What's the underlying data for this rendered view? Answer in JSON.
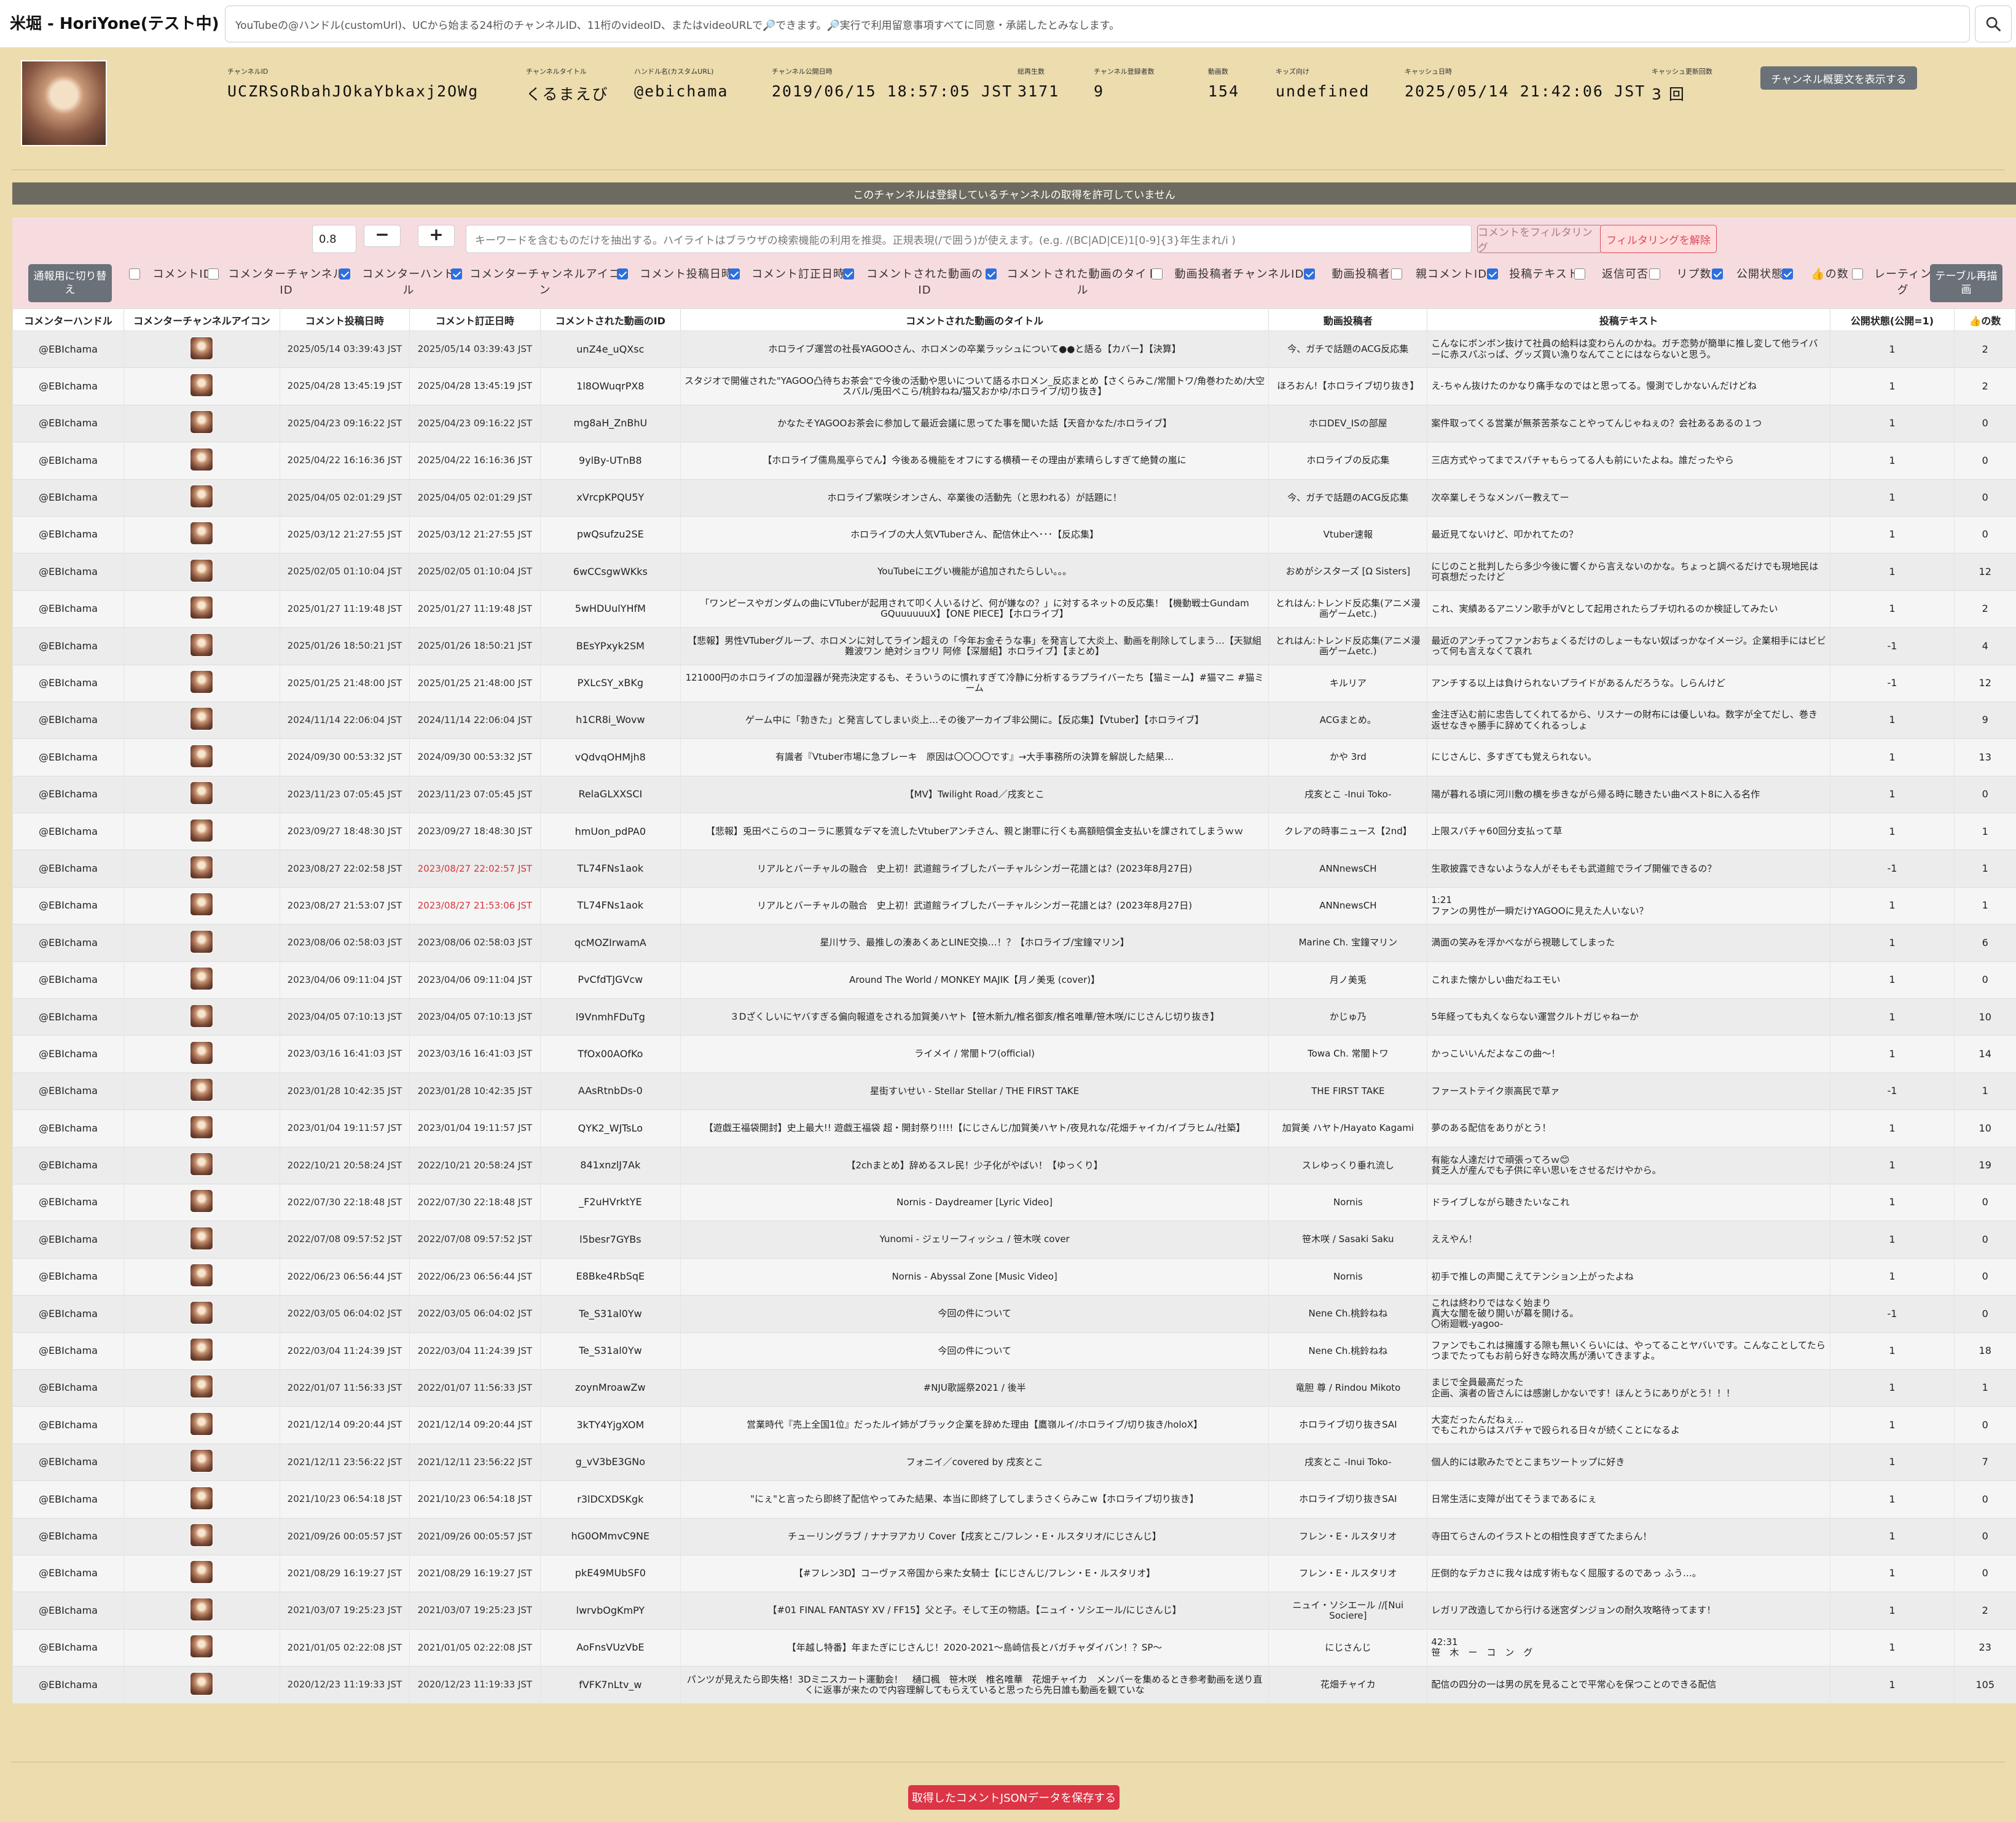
{
  "app": {
    "title": "米堀 - HoriYone(テスト中)"
  },
  "search": {
    "placeholder": "YouTubeの@ハンドル(customUrl)、UCから始まる24桁のチャンネルID、11桁のvideoID、またはvideoURLで🔎できます。🔎実行で利用留意事項すべてに同意・承諾したとみなします。"
  },
  "channel": {
    "labels": {
      "id": "チャンネルID",
      "title": "チャンネルタイトル",
      "handle": "ハンドル名(カスタムURL)",
      "published": "チャンネル公開日時",
      "views": "総再生数",
      "subscribers": "チャンネル登録者数",
      "videos": "動画数",
      "kids": "キッズ向け",
      "cached": "キャッシュ日時",
      "cache_count": "キャッシュ更新回数"
    },
    "id": "UCZRSoRbahJOkaYbkaxj2OWg",
    "title": "くるまえび",
    "handle": "@ebichama",
    "published": "2019/06/15 18:57:05 JST",
    "views": "3171",
    "subscribers": "9",
    "videos": "154",
    "kids": "undefined",
    "cached": "2025/05/14 21:42:06 JST",
    "cache_count": "3 回",
    "show_about_label": "チャンネル概要文を表示する"
  },
  "notice": "このチャンネルは登録しているチャンネルの取得を許可していません",
  "filter": {
    "zoom": "0.8",
    "minus": "−",
    "plus": "+",
    "placeholder": "キーワードを含むものだけを抽出する。ハイライトはブラウザの検索機能の利用を推奨。正規表現(/で囲う)が使えます。(e.g. /(BC|AD|CE)1[0-9]{3}年生まれ/i )",
    "filter_label": "コメントをフィルタリング",
    "clear_label": "フィルタリングを解除",
    "mobile_label": "通報用に切り替え",
    "redraw_label": "テーブル再描画",
    "toggles": [
      {
        "label": "コメントID",
        "checked": false
      },
      {
        "label": "コメンターチャンネルID",
        "checked": false
      },
      {
        "label": "コメンターハンドル",
        "checked": true
      },
      {
        "label": "コメンターチャンネルアイコン",
        "checked": true
      },
      {
        "label": "コメント投稿日時",
        "checked": true
      },
      {
        "label": "コメント訂正日時",
        "checked": true
      },
      {
        "label": "コメントされた動画のID",
        "checked": true
      },
      {
        "label": "コメントされた動画のタイトル",
        "checked": true
      },
      {
        "label": "動画投稿者チャンネルID",
        "checked": false
      },
      {
        "label": "動画投稿者",
        "checked": true
      },
      {
        "label": "親コメントID",
        "checked": false
      },
      {
        "label": "投稿テキスト",
        "checked": true
      },
      {
        "label": "返信可否",
        "checked": false
      },
      {
        "label": "リプ数",
        "checked": false
      },
      {
        "label": "公開状態",
        "checked": true
      },
      {
        "label": "👍の数",
        "checked": true
      },
      {
        "label": "レーティング",
        "checked": false
      }
    ]
  },
  "table": {
    "headers": [
      "コメンターハンドル",
      "コメンターチャンネルアイコン",
      "コメント投稿日時",
      "コメント訂正日時",
      "コメントされた動画のID",
      "コメントされた動画のタイトル",
      "動画投稿者",
      "投稿テキスト",
      "公開状態(公開=1)",
      "👍の数"
    ],
    "rows": [
      {
        "handle": "@EBIchama",
        "posted": "2025/05/14 03:39:43 JST",
        "edited": "2025/05/14 03:39:43 JST",
        "edited_flag": false,
        "video_id": "unZ4e_uQXsc",
        "title": "ホロライブ運営の社長YAGOOさん、ホロメンの卒業ラッシュについて●●と語る【カバー】【決算】",
        "uploader": "今、ガチで話題のACG反応集",
        "text": "こんなにボンボン抜けて社員の給料は変わらんのかね。ガチ恋勢が簡単に推し変して他ライバーに赤スパぶっぱ、グッズ買い漁りなんてことにはならないと思う。",
        "status": "1",
        "likes": "2"
      },
      {
        "handle": "@EBIchama",
        "posted": "2025/04/28 13:45:19 JST",
        "edited": "2025/04/28 13:45:19 JST",
        "edited_flag": false,
        "video_id": "1l8OWuqrPX8",
        "title": "スタジオで開催された\"YAGOO凸待ちお茶会\"で今後の活動や思いについて語るホロメン_反応まとめ【さくらみこ/常闇トワ/角巻わため/大空スバル/兎田ぺこら/桃鈴ねね/猫又おかゆ/ホロライブ/切り抜き】",
        "uploader": "ほろおん!【ホロライブ切り抜き】",
        "text": "え-ちゃん抜けたのかなり痛手なのではと思ってる。慢測でしかないんだけどね",
        "status": "1",
        "likes": "2"
      },
      {
        "handle": "@EBIchama",
        "posted": "2025/04/23 09:16:22 JST",
        "edited": "2025/04/23 09:16:22 JST",
        "edited_flag": false,
        "video_id": "mg8aH_ZnBhU",
        "title": "かなたそYAGOOお茶会に参加して最近会議に思ってた事を聞いた話【天音かなた/ホロライブ】",
        "uploader": "ホロDEV_ISの部屋",
        "text": "案件取ってくる営業が無茶苦茶なことやってんじゃねぇの？会社あるあるの１つ",
        "status": "1",
        "likes": "0"
      },
      {
        "handle": "@EBIchama",
        "posted": "2025/04/22 16:16:36 JST",
        "edited": "2025/04/22 16:16:36 JST",
        "edited_flag": false,
        "video_id": "9ylBy-UTnB8",
        "title": "【ホロライブ儒鳥風亭らでん】今後ある機能をオフにする横積ーその理由が素晴らしすぎて絶賛の嵐に",
        "uploader": "ホロライブの反応集",
        "text": "三店方式やってまでスパチャもらってる人も前にいたよね。誰だったやら",
        "status": "1",
        "likes": "0"
      },
      {
        "handle": "@EBIchama",
        "posted": "2025/04/05 02:01:29 JST",
        "edited": "2025/04/05 02:01:29 JST",
        "edited_flag": false,
        "video_id": "xVrcpKPQU5Y",
        "title": "ホロライブ紫咲シオンさん、卒業後の活動先（と思われる）が話題に！",
        "uploader": "今、ガチで話題のACG反応集",
        "text": "次卒業しそうなメンバー教えてー",
        "status": "1",
        "likes": "0"
      },
      {
        "handle": "@EBIchama",
        "posted": "2025/03/12 21:27:55 JST",
        "edited": "2025/03/12 21:27:55 JST",
        "edited_flag": false,
        "video_id": "pwQsufzu2SE",
        "title": "ホロライブの大人気VTuberさん、配信休止へ･･･【反応集】",
        "uploader": "Vtuber速報",
        "text": "最近見てないけど、叩かれてたの？",
        "status": "1",
        "likes": "0"
      },
      {
        "handle": "@EBIchama",
        "posted": "2025/02/05 01:10:04 JST",
        "edited": "2025/02/05 01:10:04 JST",
        "edited_flag": false,
        "video_id": "6wCCsgwWKks",
        "title": "YouTubeにエグい機能が追加されたらしい。。。",
        "uploader": "おめがシスターズ [Ω Sisters]",
        "text": "にじのこと批判したら多少今後に響くから言えないのかな。ちょっと調べるだけでも現地民は可哀想だったけど",
        "status": "1",
        "likes": "12"
      },
      {
        "handle": "@EBIchama",
        "posted": "2025/01/27 11:19:48 JST",
        "edited": "2025/01/27 11:19:48 JST",
        "edited_flag": false,
        "video_id": "5wHDUulYHfM",
        "title": "「ワンピースやガンダムの曲にVTuberが起用されて叩く人いるけど、何が嫌なの？」に対するネットの反応集！【機動戦士Gundam GQuuuuuuX】【ONE PIECE】【ホロライブ】",
        "uploader": "とれはん:トレンド反応集(アニメ漫画ゲームetc.)",
        "text": "これ、実績あるアニソン歌手がVとして起用されたらブチ切れるのか検証してみたい",
        "status": "1",
        "likes": "2"
      },
      {
        "handle": "@EBIchama",
        "posted": "2025/01/26 18:50:21 JST",
        "edited": "2025/01/26 18:50:21 JST",
        "edited_flag": false,
        "video_id": "BEsYPxyk2SM",
        "title": "【悲報】男性VTuberグループ、ホロメンに対してライン超えの「今年お金そうな事」を発言して大炎上、動画を削除してしまう…【天獄組 難波ワン 絶対ショウリ 阿修【深層組】ホロライブ】【まとめ】",
        "uploader": "とれはん:トレンド反応集(アニメ漫画ゲームetc.)",
        "text": "最近のアンチってファンおちょくるだけのしょーもない奴ばっかなイメージ。企業相手にはビビって何も言えなくて哀れ",
        "status": "-1",
        "likes": "4"
      },
      {
        "handle": "@EBIchama",
        "posted": "2025/01/25 21:48:00 JST",
        "edited": "2025/01/25 21:48:00 JST",
        "edited_flag": false,
        "video_id": "PXLcSY_xBKg",
        "title": "121000円のホロライブの加湿器が発売決定するも、そういうのに慣れすぎて冷静に分析するラプライバーたち【猫ミーム】#猫マニ #猫ミーム",
        "uploader": "キルリア",
        "text": "アンチする以上は負けられないプライドがあるんだろうな。しらんけど",
        "status": "-1",
        "likes": "12"
      },
      {
        "handle": "@EBIchama",
        "posted": "2024/11/14 22:06:04 JST",
        "edited": "2024/11/14 22:06:04 JST",
        "edited_flag": false,
        "video_id": "h1CR8i_Wovw",
        "title": "ゲーム中に「勃きた」と発言してしまい炎上…その後アーカイブ非公開に。【反応集】【Vtuber】【ホロライブ】",
        "uploader": "ACGまとめ。",
        "text": "金注ぎ込む前に忠告してくれてるから、リスナーの財布には優しいね。数字が全てだし、巻き返せなきゃ勝手に辞めてくれるっしょ",
        "status": "1",
        "likes": "9"
      },
      {
        "handle": "@EBIchama",
        "posted": "2024/09/30 00:53:32 JST",
        "edited": "2024/09/30 00:53:32 JST",
        "edited_flag": false,
        "video_id": "vQdvqOHMjh8",
        "title": "有識者『Vtuber市場に急ブレーキ　原因は〇〇〇〇です』→大手事務所の決算を解説した結果…",
        "uploader": "かや 3rd",
        "text": "にじさんじ、多すぎても覚えられない。",
        "status": "1",
        "likes": "13"
      },
      {
        "handle": "@EBIchama",
        "posted": "2023/11/23 07:05:45 JST",
        "edited": "2023/11/23 07:05:45 JST",
        "edited_flag": false,
        "video_id": "RelaGLXXSCI",
        "title": "【MV】Twilight Road／戌亥とこ",
        "uploader": "戌亥とこ -Inui Toko-",
        "text": "陽が暮れる頃に河川敷の横を歩きながら帰る時に聴きたい曲ベスト8に入る名作",
        "status": "1",
        "likes": "0"
      },
      {
        "handle": "@EBIchama",
        "posted": "2023/09/27 18:48:30 JST",
        "edited": "2023/09/27 18:48:30 JST",
        "edited_flag": false,
        "video_id": "hmUon_pdPA0",
        "title": "【悲報】兎田ぺこらのコーラに悪質なデマを流したVtuberアンチさん、親と謝罪に行くも高額賠償金支払いを課されてしまうｗｗ",
        "uploader": "クレアの時事ニュース【2nd】",
        "text": "上限スパチャ60回分支払って草",
        "status": "1",
        "likes": "1"
      },
      {
        "handle": "@EBIchama",
        "posted": "2023/08/27 22:02:58 JST",
        "edited": "2023/08/27 22:02:57 JST",
        "edited_flag": true,
        "video_id": "TL74FNs1aok",
        "title": "リアルとバーチャルの融合　史上初！武道館ライブしたバーチャルシンガー花譜とは？(2023年8月27日)",
        "uploader": "ANNnewsCH",
        "text": "生歌披露できないような人がそもそも武道館でライブ開催できるの？",
        "status": "-1",
        "likes": "1"
      },
      {
        "handle": "@EBIchama",
        "posted": "2023/08/27 21:53:07 JST",
        "edited": "2023/08/27 21:53:06 JST",
        "edited_flag": true,
        "video_id": "TL74FNs1aok",
        "title": "リアルとバーチャルの融合　史上初！武道館ライブしたバーチャルシンガー花譜とは？(2023年8月27日)",
        "uploader": "ANNnewsCH",
        "text": "1:21\nファンの男性が一瞬だけYAGOOに見えた人いない？",
        "status": "1",
        "likes": "1"
      },
      {
        "handle": "@EBIchama",
        "posted": "2023/08/06 02:58:03 JST",
        "edited": "2023/08/06 02:58:03 JST",
        "edited_flag": false,
        "video_id": "qcMOZIrwamA",
        "title": "星川サラ、最推しの湊あくあとLINE交換…！？【ホロライブ/宝鐘マリン】",
        "uploader": "Marine Ch. 宝鐘マリン",
        "text": "満面の笑みを浮かべながら視聴してしまった",
        "status": "1",
        "likes": "6"
      },
      {
        "handle": "@EBIchama",
        "posted": "2023/04/06 09:11:04 JST",
        "edited": "2023/04/06 09:11:04 JST",
        "edited_flag": false,
        "video_id": "PvCfdTJGVcw",
        "title": "Around The World / MONKEY MAJIK【月ノ美兎 (cover)】",
        "uploader": "月ノ美兎",
        "text": "これまた懐かしい曲だねエモい",
        "status": "1",
        "likes": "0"
      },
      {
        "handle": "@EBIchama",
        "posted": "2023/04/05 07:10:13 JST",
        "edited": "2023/04/05 07:10:13 JST",
        "edited_flag": false,
        "video_id": "l9VnmhFDuTg",
        "title": "３Dざくしいにヤバすぎる偏向報道をされる加賀美ハヤト【笹木新九/椎名御亥/椎名唯華/笹木咲/にじさんじ切り抜き】",
        "uploader": "かじゅ乃",
        "text": "5年経っても丸くならない運営クルトガじゃねーか",
        "status": "1",
        "likes": "10"
      },
      {
        "handle": "@EBIchama",
        "posted": "2023/03/16 16:41:03 JST",
        "edited": "2023/03/16 16:41:03 JST",
        "edited_flag": false,
        "video_id": "TfOx00AOfKo",
        "title": "ライメイ / 常闇トワ(official)",
        "uploader": "Towa Ch. 常闇トワ",
        "text": "かっこいいんだよなこの曲〜！",
        "status": "1",
        "likes": "14"
      },
      {
        "handle": "@EBIchama",
        "posted": "2023/01/28 10:42:35 JST",
        "edited": "2023/01/28 10:42:35 JST",
        "edited_flag": false,
        "video_id": "AAsRtnbDs-0",
        "title": "星街すいせい - Stellar Stellar / THE FIRST TAKE",
        "uploader": "THE FIRST TAKE",
        "text": "ファーストテイク崇高民で草ァ",
        "status": "-1",
        "likes": "1"
      },
      {
        "handle": "@EBIchama",
        "posted": "2023/01/04 19:11:57 JST",
        "edited": "2023/01/04 19:11:57 JST",
        "edited_flag": false,
        "video_id": "QYK2_WJTsLo",
        "title": "【遊戯王福袋開封】史上最大!! 遊戯王福袋 超・開封祭り!!!!【にじさんじ/加賀美ハヤト/夜見れな/花畑チャイカ/イブラヒム/社築】",
        "uploader": "加賀美 ハヤト/Hayato Kagami",
        "text": "夢のある配信をありがとう！",
        "status": "1",
        "likes": "10"
      },
      {
        "handle": "@EBIchama",
        "posted": "2022/10/21 20:58:24 JST",
        "edited": "2022/10/21 20:58:24 JST",
        "edited_flag": false,
        "video_id": "841xnzlJ7Ak",
        "title": "【2chまとめ】辞めるスレ民！少子化がやばい！【ゆっくり】",
        "uploader": "スレゆっくり垂れ流し",
        "text": "有能な人達だけで頑張ってろｗ😊\n貧乏人が産んでも子供に辛い思いをさせるだけやから。",
        "status": "1",
        "likes": "19"
      },
      {
        "handle": "@EBIchama",
        "posted": "2022/07/30 22:18:48 JST",
        "edited": "2022/07/30 22:18:48 JST",
        "edited_flag": false,
        "video_id": "_F2uHVrktYE",
        "title": "Nornis - Daydreamer [Lyric Video]",
        "uploader": "Nornis",
        "text": "ドライブしながら聴きたいなこれ",
        "status": "1",
        "likes": "0"
      },
      {
        "handle": "@EBIchama",
        "posted": "2022/07/08 09:57:52 JST",
        "edited": "2022/07/08 09:57:52 JST",
        "edited_flag": false,
        "video_id": "l5besr7GYBs",
        "title": "Yunomi - ジェリーフィッシュ / 笹木咲 cover",
        "uploader": "笹木咲 / Sasaki Saku",
        "text": "ええやん！",
        "status": "1",
        "likes": "0"
      },
      {
        "handle": "@EBIchama",
        "posted": "2022/06/23 06:56:44 JST",
        "edited": "2022/06/23 06:56:44 JST",
        "edited_flag": false,
        "video_id": "E8Bke4RbSqE",
        "title": "Nornis - Abyssal Zone [Music Video]",
        "uploader": "Nornis",
        "text": "初手で推しの声聞こえてテンション上がったよね",
        "status": "1",
        "likes": "0"
      },
      {
        "handle": "@EBIchama",
        "posted": "2022/03/05 06:04:02 JST",
        "edited": "2022/03/05 06:04:02 JST",
        "edited_flag": false,
        "video_id": "Te_S31al0Yw",
        "title": "今回の件について",
        "uploader": "Nene Ch.桃鈴ねね",
        "text": "これは終わりではなく始まり\n真大な闇を破り開いが幕を開ける。\n〇術廻戦-yagoo-",
        "status": "-1",
        "likes": "0"
      },
      {
        "handle": "@EBIchama",
        "posted": "2022/03/04 11:24:39 JST",
        "edited": "2022/03/04 11:24:39 JST",
        "edited_flag": false,
        "video_id": "Te_S31al0Yw",
        "title": "今回の件について",
        "uploader": "Nene Ch.桃鈴ねね",
        "text": "ファンでもこれは擁護する隙も無いくらいには、やってることヤバいです。こんなことしてたらつまでたってもお前ら好きな時次馬が湧いてきますよ。",
        "status": "1",
        "likes": "18"
      },
      {
        "handle": "@EBIchama",
        "posted": "2022/01/07 11:56:33 JST",
        "edited": "2022/01/07 11:56:33 JST",
        "edited_flag": false,
        "video_id": "zoynMroawZw",
        "title": "#NJU歌謡祭2021 / 後半",
        "uploader": "竜胆 尊 / Rindou Mikoto",
        "text": "まじで全員最高だった\n企画、演者の皆さんには感謝しかないです！ほんとうにありがとう！！！",
        "status": "1",
        "likes": "1"
      },
      {
        "handle": "@EBIchama",
        "posted": "2021/12/14 09:20:44 JST",
        "edited": "2021/12/14 09:20:44 JST",
        "edited_flag": false,
        "video_id": "3kTY4YjgXOM",
        "title": "営業時代『売上全国1位』だったルイ姉がブラック企業を辞めた理由【鷹嶺ルイ/ホロライブ/切り抜き/holoX】",
        "uploader": "ホロライブ切り抜きSAI",
        "text": "大変だったんだねぇ…\nでもこれからはスパチャで殴られる日々が続くことになるよ",
        "status": "1",
        "likes": "0"
      },
      {
        "handle": "@EBIchama",
        "posted": "2021/12/11 23:56:22 JST",
        "edited": "2021/12/11 23:56:22 JST",
        "edited_flag": false,
        "video_id": "g_vV3bE3GNo",
        "title": "フォニイ／covered by 戌亥とこ",
        "uploader": "戌亥とこ -Inui Toko-",
        "text": "個人的には歌みたでとこまちツートップに好き",
        "status": "1",
        "likes": "7"
      },
      {
        "handle": "@EBIchama",
        "posted": "2021/10/23 06:54:18 JST",
        "edited": "2021/10/23 06:54:18 JST",
        "edited_flag": false,
        "video_id": "r3lDCXDSKgk",
        "title": "\"にぇ\"と言ったら即終了配信やってみた結果、本当に即終了してしまうさくらみこw【ホロライブ切り抜き】",
        "uploader": "ホロライブ切り抜きSAI",
        "text": "日常生活に支障が出てそうまであるにぇ",
        "status": "1",
        "likes": "0"
      },
      {
        "handle": "@EBIchama",
        "posted": "2021/09/26 00:05:57 JST",
        "edited": "2021/09/26 00:05:57 JST",
        "edited_flag": false,
        "video_id": "hG0OMmvC9NE",
        "title": "チューリングラブ / ナナヲアカリ Cover【戌亥とこ/フレン・E・ルスタリオ/にじさんじ】",
        "uploader": "フレン・E・ルスタリオ",
        "text": "寺田てらさんのイラストとの相性良すぎてたまらん！",
        "status": "1",
        "likes": "0"
      },
      {
        "handle": "@EBIchama",
        "posted": "2021/08/29 16:19:27 JST",
        "edited": "2021/08/29 16:19:27 JST",
        "edited_flag": false,
        "video_id": "pkE49MUbSF0",
        "title": "【#フレン3D】コーヴァス帝国から来た女騎士【にじさんじ/フレン・E・ルスタリオ】",
        "uploader": "フレン・E・ルスタリオ",
        "text": "圧倒的なデカさに我々は成す術もなく屈服するのであっ ふう…。",
        "status": "1",
        "likes": "0"
      },
      {
        "handle": "@EBIchama",
        "posted": "2021/03/07 19:25:23 JST",
        "edited": "2021/03/07 19:25:23 JST",
        "edited_flag": false,
        "video_id": "lwrvbOgKmPY",
        "title": "【#01 FINAL FANTASY XV / FF15】父と子。そして王の物語。【ニュイ・ソシエール/にじさんじ】",
        "uploader": "ニュイ・ソシエール //[Nui Sociere]",
        "text": "レガリア改造してから行ける迷宮ダンジョンの耐久攻略待ってます！",
        "status": "1",
        "likes": "2"
      },
      {
        "handle": "@EBIchama",
        "posted": "2021/01/05 02:22:08 JST",
        "edited": "2021/01/05 02:22:08 JST",
        "edited_flag": false,
        "video_id": "AoFnsVUzVbE",
        "title": "【年越し特番】年またぎにじさんじ！2020-2021～島崎信長とバガチャダイバン！？SP～",
        "uploader": "にじさんじ",
        "text": "42:31\n笹　木　ー　コ　ン　グ",
        "status": "1",
        "likes": "23"
      },
      {
        "handle": "@EBIchama",
        "posted": "2020/12/23 11:19:33 JST",
        "edited": "2020/12/23 11:19:33 JST",
        "edited_flag": false,
        "video_id": "fVFK7nLtv_w",
        "title": "パンツが見えたら即失格！3Dミニスカート運動会！　樋口楓　笹木咲　椎名唯華　花畑チャイカ　メンバーを集めるとき参考動画を送り直くに返事が来たので内容理解してもらえていると思ったら先日誰も動画を観ていな",
        "uploader": "花畑チャイカ",
        "text": "配信の四分の一は男の尻を見ることで平常心を保つことのできる配信",
        "status": "1",
        "likes": "105"
      }
    ]
  },
  "footer": {
    "save_label": "取得したコメントJSONデータを保存する"
  }
}
